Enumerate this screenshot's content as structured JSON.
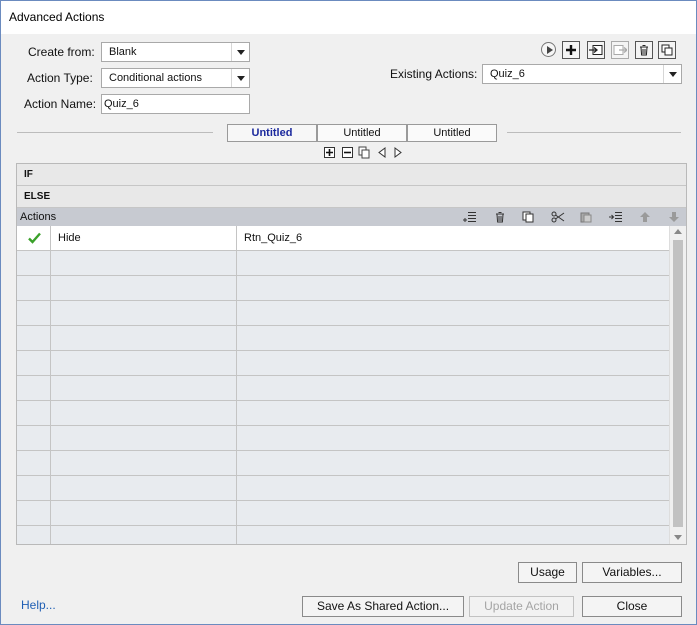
{
  "window": {
    "title": "Advanced Actions"
  },
  "form": {
    "create_from_label": "Create from:",
    "create_from_value": "Blank",
    "action_type_label": "Action Type:",
    "action_type_value": "Conditional actions",
    "action_name_label": "Action Name:",
    "action_name_value": "Quiz_6",
    "existing_actions_label": "Existing Actions:",
    "existing_actions_value": "Quiz_6"
  },
  "tabs": [
    {
      "label": "Untitled",
      "active": true
    },
    {
      "label": "Untitled",
      "active": false
    },
    {
      "label": "Untitled",
      "active": false
    }
  ],
  "sections": {
    "if_label": "IF",
    "else_label": "ELSE",
    "actions_label": "Actions"
  },
  "actions_table": {
    "rows": [
      {
        "checked": true,
        "action": "Hide",
        "target": "Rtn_Quiz_6"
      }
    ]
  },
  "buttons": {
    "usage": "Usage",
    "variables": "Variables...",
    "save_shared": "Save As Shared Action...",
    "update_action": "Update Action",
    "close": "Close"
  },
  "help_link": "Help...",
  "colors": {
    "active_tab_text": "#1c2a9e",
    "link": "#1f5fb4",
    "actions_bar": "#c7cad1",
    "check": "#3aa12a"
  },
  "icons": {
    "toolbar": [
      "play-icon",
      "add-icon",
      "import-icon",
      "export-icon",
      "delete-icon",
      "duplicate-icon"
    ],
    "actions_bar": [
      "insert-row-icon",
      "delete-row-icon",
      "copy-row-icon",
      "cut-row-icon",
      "paste-row-icon",
      "indent-row-icon",
      "move-up-icon",
      "move-down-icon"
    ]
  }
}
